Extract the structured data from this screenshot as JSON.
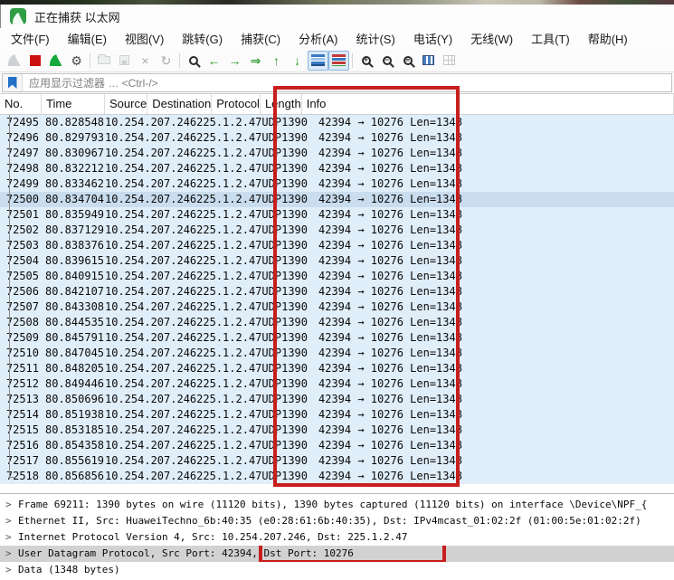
{
  "title_bar": {
    "title": "正在捕获 以太网"
  },
  "menu_bar": {
    "items": [
      "文件(F)",
      "编辑(E)",
      "视图(V)",
      "跳转(G)",
      "捕获(C)",
      "分析(A)",
      "统计(S)",
      "电话(Y)",
      "无线(W)",
      "工具(T)",
      "帮助(H)"
    ]
  },
  "toolbar": {
    "buttons": [
      {
        "name": "start-capture",
        "glyph": "fin",
        "state": "disabled"
      },
      {
        "name": "stop-capture",
        "glyph": "stop",
        "state": "normal"
      },
      {
        "name": "restart-capture",
        "glyph": "fin-green",
        "state": "normal"
      },
      {
        "name": "capture-options",
        "glyph": "gear",
        "state": "normal"
      },
      {
        "name": "separator"
      },
      {
        "name": "open-file",
        "glyph": "folder",
        "state": "disabled"
      },
      {
        "name": "save-file",
        "glyph": "save",
        "state": "disabled"
      },
      {
        "name": "close-file",
        "glyph": "close",
        "state": "disabled"
      },
      {
        "name": "reload-file",
        "glyph": "reload",
        "state": "disabled"
      },
      {
        "name": "separator"
      },
      {
        "name": "find-packet",
        "glyph": "magnifier",
        "state": "normal"
      },
      {
        "name": "go-back",
        "glyph": "arrow-left",
        "state": "normal"
      },
      {
        "name": "go-forward",
        "glyph": "arrow-right",
        "state": "normal"
      },
      {
        "name": "go-to-packet",
        "glyph": "goto",
        "state": "normal"
      },
      {
        "name": "first-packet",
        "glyph": "arrow-up",
        "state": "normal"
      },
      {
        "name": "last-packet",
        "glyph": "arrow-down",
        "state": "normal"
      },
      {
        "name": "auto-scroll",
        "glyph": "autoscroll",
        "state": "active"
      },
      {
        "name": "colorize",
        "glyph": "colorize",
        "state": "active"
      },
      {
        "name": "separator"
      },
      {
        "name": "zoom-in",
        "glyph": "zoom-in",
        "state": "normal"
      },
      {
        "name": "zoom-out",
        "glyph": "zoom-out",
        "state": "normal"
      },
      {
        "name": "zoom-reset",
        "glyph": "zoom-reset",
        "state": "normal"
      },
      {
        "name": "resize-columns",
        "glyph": "resize-columns",
        "state": "normal"
      },
      {
        "name": "number-columns",
        "glyph": "number-columns",
        "state": "disabled"
      }
    ]
  },
  "filter_bar": {
    "placeholder": "应用显示过滤器 … <Ctrl-/>"
  },
  "packet_list": {
    "columns": [
      {
        "key": "no",
        "label": "No."
      },
      {
        "key": "time",
        "label": "Time"
      },
      {
        "key": "source",
        "label": "Source"
      },
      {
        "key": "destination",
        "label": "Destination"
      },
      {
        "key": "protocol",
        "label": "Protocol"
      },
      {
        "key": "length",
        "label": "Length"
      },
      {
        "key": "info",
        "label": "Info"
      }
    ],
    "selected_no": "72500",
    "rows": [
      {
        "no": "72495",
        "time": "80.828548",
        "source": "10.254.207.246",
        "destination": "225.1.2.47",
        "protocol": "UDP",
        "length": "1390",
        "info": "42394 → 10276 Len=1348"
      },
      {
        "no": "72496",
        "time": "80.829793",
        "source": "10.254.207.246",
        "destination": "225.1.2.47",
        "protocol": "UDP",
        "length": "1390",
        "info": "42394 → 10276 Len=1348"
      },
      {
        "no": "72497",
        "time": "80.830967",
        "source": "10.254.207.246",
        "destination": "225.1.2.47",
        "protocol": "UDP",
        "length": "1390",
        "info": "42394 → 10276 Len=1348"
      },
      {
        "no": "72498",
        "time": "80.832212",
        "source": "10.254.207.246",
        "destination": "225.1.2.47",
        "protocol": "UDP",
        "length": "1390",
        "info": "42394 → 10276 Len=1348"
      },
      {
        "no": "72499",
        "time": "80.833462",
        "source": "10.254.207.246",
        "destination": "225.1.2.47",
        "protocol": "UDP",
        "length": "1390",
        "info": "42394 → 10276 Len=1348"
      },
      {
        "no": "72500",
        "time": "80.834704",
        "source": "10.254.207.246",
        "destination": "225.1.2.47",
        "protocol": "UDP",
        "length": "1390",
        "info": "42394 → 10276 Len=1348"
      },
      {
        "no": "72501",
        "time": "80.835949",
        "source": "10.254.207.246",
        "destination": "225.1.2.47",
        "protocol": "UDP",
        "length": "1390",
        "info": "42394 → 10276 Len=1348"
      },
      {
        "no": "72502",
        "time": "80.837129",
        "source": "10.254.207.246",
        "destination": "225.1.2.47",
        "protocol": "UDP",
        "length": "1390",
        "info": "42394 → 10276 Len=1348"
      },
      {
        "no": "72503",
        "time": "80.838376",
        "source": "10.254.207.246",
        "destination": "225.1.2.47",
        "protocol": "UDP",
        "length": "1390",
        "info": "42394 → 10276 Len=1348"
      },
      {
        "no": "72504",
        "time": "80.839615",
        "source": "10.254.207.246",
        "destination": "225.1.2.47",
        "protocol": "UDP",
        "length": "1390",
        "info": "42394 → 10276 Len=1348"
      },
      {
        "no": "72505",
        "time": "80.840915",
        "source": "10.254.207.246",
        "destination": "225.1.2.47",
        "protocol": "UDP",
        "length": "1390",
        "info": "42394 → 10276 Len=1348"
      },
      {
        "no": "72506",
        "time": "80.842107",
        "source": "10.254.207.246",
        "destination": "225.1.2.47",
        "protocol": "UDP",
        "length": "1390",
        "info": "42394 → 10276 Len=1348"
      },
      {
        "no": "72507",
        "time": "80.843308",
        "source": "10.254.207.246",
        "destination": "225.1.2.47",
        "protocol": "UDP",
        "length": "1390",
        "info": "42394 → 10276 Len=1348"
      },
      {
        "no": "72508",
        "time": "80.844535",
        "source": "10.254.207.246",
        "destination": "225.1.2.47",
        "protocol": "UDP",
        "length": "1390",
        "info": "42394 → 10276 Len=1348"
      },
      {
        "no": "72509",
        "time": "80.845791",
        "source": "10.254.207.246",
        "destination": "225.1.2.47",
        "protocol": "UDP",
        "length": "1390",
        "info": "42394 → 10276 Len=1348"
      },
      {
        "no": "72510",
        "time": "80.847045",
        "source": "10.254.207.246",
        "destination": "225.1.2.47",
        "protocol": "UDP",
        "length": "1390",
        "info": "42394 → 10276 Len=1348"
      },
      {
        "no": "72511",
        "time": "80.848205",
        "source": "10.254.207.246",
        "destination": "225.1.2.47",
        "protocol": "UDP",
        "length": "1390",
        "info": "42394 → 10276 Len=1348"
      },
      {
        "no": "72512",
        "time": "80.849446",
        "source": "10.254.207.246",
        "destination": "225.1.2.47",
        "protocol": "UDP",
        "length": "1390",
        "info": "42394 → 10276 Len=1348"
      },
      {
        "no": "72513",
        "time": "80.850696",
        "source": "10.254.207.246",
        "destination": "225.1.2.47",
        "protocol": "UDP",
        "length": "1390",
        "info": "42394 → 10276 Len=1348"
      },
      {
        "no": "72514",
        "time": "80.851938",
        "source": "10.254.207.246",
        "destination": "225.1.2.47",
        "protocol": "UDP",
        "length": "1390",
        "info": "42394 → 10276 Len=1348"
      },
      {
        "no": "72515",
        "time": "80.853185",
        "source": "10.254.207.246",
        "destination": "225.1.2.47",
        "protocol": "UDP",
        "length": "1390",
        "info": "42394 → 10276 Len=1348"
      },
      {
        "no": "72516",
        "time": "80.854358",
        "source": "10.254.207.246",
        "destination": "225.1.2.47",
        "protocol": "UDP",
        "length": "1390",
        "info": "42394 → 10276 Len=1348"
      },
      {
        "no": "72517",
        "time": "80.855619",
        "source": "10.254.207.246",
        "destination": "225.1.2.47",
        "protocol": "UDP",
        "length": "1390",
        "info": "42394 → 10276 Len=1348"
      },
      {
        "no": "72518",
        "time": "80.856856",
        "source": "10.254.207.246",
        "destination": "225.1.2.47",
        "protocol": "UDP",
        "length": "1390",
        "info": "42394 → 10276 Len=1348"
      }
    ]
  },
  "detail_pane": {
    "lines": [
      {
        "name": "frame",
        "text": "Frame 69211: 1390 bytes on wire (11120 bits), 1390 bytes captured (11120 bits) on interface \\Device\\NPF_{"
      },
      {
        "name": "ethernet",
        "text": "Ethernet II, Src: HuaweiTechno_6b:40:35 (e0:28:61:6b:40:35), Dst: IPv4mcast_01:02:2f (01:00:5e:01:02:2f)"
      },
      {
        "name": "ip",
        "text": "Internet Protocol Version 4, Src: 10.254.207.246, Dst: 225.1.2.47"
      },
      {
        "name": "udp",
        "text": "User Datagram Protocol, Src Port: 42394, ",
        "highlight": "Dst Port: 10276",
        "selected": true
      },
      {
        "name": "data",
        "text": "Data (1348 bytes)"
      }
    ]
  },
  "colors": {
    "udp_row": "#e0eefa",
    "selected_row": "#c9ddee",
    "detail_selected_bg": "#d2d2d2",
    "annotation_red": "#c81e1e",
    "accent_blue": "#2470c8"
  }
}
